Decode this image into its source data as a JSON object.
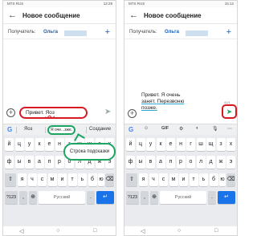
{
  "status": {
    "left": "MTS RUS",
    "time_left": "12:29",
    "time_right": "15:12"
  },
  "app": {
    "title": "Новое сообщение",
    "back_glyph": "←",
    "add_glyph": "+"
  },
  "recipient": {
    "label": "Получатель:",
    "name": "Ольга"
  },
  "left_compose": {
    "text_plain": "Привет. ",
    "text_err": "Яоз",
    "counter": "",
    "send_glyph": "➤"
  },
  "right_compose": {
    "line1": "Привет. Я очень",
    "line2": "занят. Перезвоню",
    "line3": "позже.",
    "counter": "41/1",
    "send_glyph": "➤"
  },
  "left_suggestions": [
    "Яоз",
    "Я оче...зже.",
    "Создание"
  ],
  "right_toolbar": [
    "GIF"
  ],
  "callout": {
    "text": "Строка подсказки"
  },
  "keyboard": {
    "row1": [
      "й",
      "ц",
      "у",
      "к",
      "е",
      "н",
      "г",
      "ш",
      "щ",
      "з",
      "х"
    ],
    "row2": [
      "ф",
      "ы",
      "в",
      "а",
      "п",
      "р",
      "о",
      "л",
      "д",
      "ж",
      "э"
    ],
    "row3": [
      "я",
      "ч",
      "с",
      "м",
      "и",
      "т",
      "ь",
      "б",
      "ю"
    ],
    "shift": "⇧",
    "backspace": "⌫",
    "num": "?123",
    "comma": ",",
    "lang": "⊕",
    "space": "Русский",
    "dot": ".",
    "enter": "↵"
  },
  "colors": {
    "accent_red": "#d71921",
    "accent_green": "#1da462",
    "enter_blue": "#1a73e8"
  }
}
